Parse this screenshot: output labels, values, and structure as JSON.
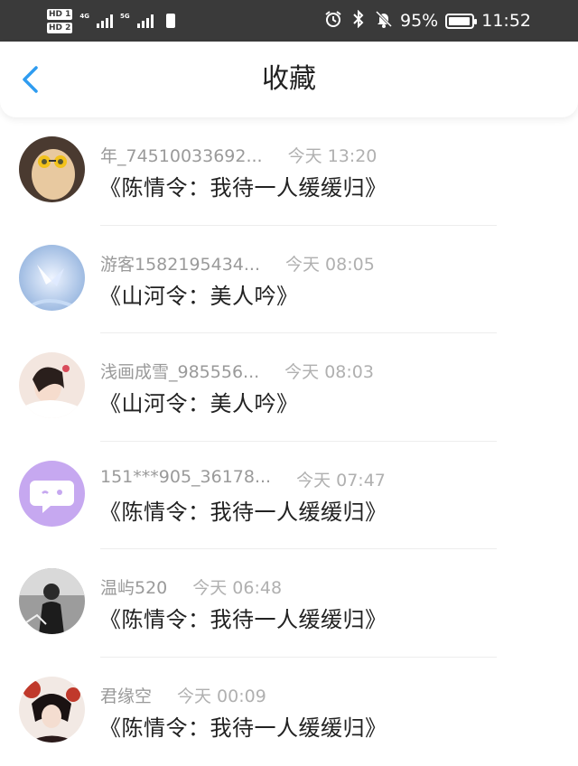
{
  "status_bar": {
    "hd1": "HD 1",
    "hd2": "HD 2",
    "net1": "4G",
    "net2": "5G",
    "battery_percent": "95%",
    "time": "11:52",
    "icons": [
      "alarm-icon",
      "bluetooth-icon",
      "mute-bell-icon",
      "battery-icon"
    ]
  },
  "header": {
    "title": "收藏",
    "back_icon": "chevron-left-icon",
    "accent_color": "#2f9cf0"
  },
  "favorites": [
    {
      "user": "年_74510033692...",
      "time": "今天 13:20",
      "message": "《陈情令：我待一人缓缓归》",
      "avatar_bg": "#c9a98a"
    },
    {
      "user": "游客1582195434...",
      "time": "今天 08:05",
      "message": "《山河令：美人吟》",
      "avatar_bg": "#a9c4e6"
    },
    {
      "user": "浅画成雪_985556...",
      "time": "今天 08:03",
      "message": "《山河令：美人吟》",
      "avatar_bg": "#e8d0c4"
    },
    {
      "user": "151***905_36178...",
      "time": "今天 07:47",
      "message": "《陈情令：我待一人缓缓归》",
      "avatar_bg": "#c6a8f0"
    },
    {
      "user": "温屿520",
      "time": "今天 06:48",
      "message": "《陈情令：我待一人缓缓归》",
      "avatar_bg": "#6d6d6d"
    },
    {
      "user": "君缘空",
      "time": "今天 00:09",
      "message": "《陈情令：我待一人缓缓归》",
      "avatar_bg": "#b43a2e"
    }
  ]
}
